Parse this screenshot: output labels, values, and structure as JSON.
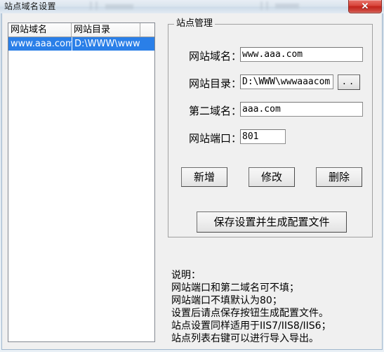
{
  "window": {
    "title": "站点域名设置",
    "close_glyph": "✕"
  },
  "site_list": {
    "columns": [
      "网站域名",
      "网站目录",
      ""
    ],
    "rows": [
      {
        "domain": "www.aaa.com",
        "directory": "D:\\WWW\\wwwa",
        "extra": ""
      }
    ]
  },
  "site_manage": {
    "legend": "站点管理",
    "fields": {
      "domain_label": "网站域名：",
      "domain_value": "www.aaa.com",
      "dir_label": "网站目录：",
      "dir_value": "D:\\WWW\\wwwaaacom",
      "browse_label": "..",
      "second_label": "第二域名：",
      "second_value": "aaa.com",
      "port_label": "网站端口：",
      "port_value": "801"
    },
    "buttons": {
      "add": "新增",
      "edit": "修改",
      "delete": "删除",
      "save": "保存设置并生成配置文件"
    }
  },
  "explanation": "说明：\n网站端口和第二域名可不填；\n网站端口不填默认为80；\n设置后请点保存按钮生成配置文件。\n站点设置同样适用于IIS7/IIS8/IIS6；\n站点列表右键可以进行导入导出。",
  "colors": {
    "selection": "#2a7fe8",
    "close_button": "#c2231b",
    "client_bg": "#f0f0f0"
  }
}
